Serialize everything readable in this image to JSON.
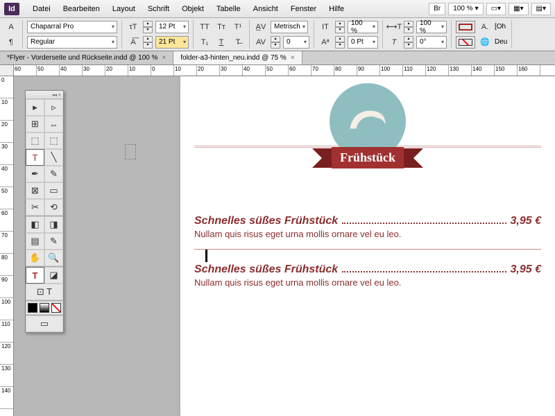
{
  "app": "Id",
  "menu": [
    "Datei",
    "Bearbeiten",
    "Layout",
    "Schrift",
    "Objekt",
    "Tabelle",
    "Ansicht",
    "Fenster",
    "Hilfe"
  ],
  "menuRight": {
    "br": "Br",
    "zoom": "100 %"
  },
  "ctrl": {
    "font": "Chaparral Pro",
    "style": "Regular",
    "size": "12 Pt",
    "leading": "21 Pt",
    "kernMode": "Metrisch",
    "kernVal": "0",
    "vshift": "0 Pt",
    "vscale": "100 %",
    "hscale": "100 %",
    "baseline": "0 Pt",
    "skew": "0°",
    "oh": "[Oh",
    "deu": "Deu"
  },
  "tabs": [
    {
      "label": "*Flyer - Vorderseite und Rückseite.indd @ 100 %",
      "active": false
    },
    {
      "label": "folder-a3-hinten_neu.indd @ 75 %",
      "active": true
    }
  ],
  "hruler": [
    "60",
    "50",
    "40",
    "30",
    "20",
    "10",
    "0",
    "10",
    "20",
    "30",
    "40",
    "50",
    "60",
    "70",
    "80",
    "90",
    "100",
    "110",
    "120",
    "130",
    "140",
    "150",
    "160"
  ],
  "vruler": [
    "0",
    "10",
    "20",
    "30",
    "40",
    "50",
    "60",
    "70",
    "80",
    "90",
    "100",
    "110",
    "120",
    "130",
    "140"
  ],
  "doc": {
    "badge": "Frühstück",
    "item1": {
      "name": "Schnelles süßes Frühstück",
      "price": "3,95 €",
      "desc": "Nullam quis risus eget urna mollis ornare vel eu leo."
    },
    "item2": {
      "name": "Schnelles süßes Frühstück",
      "price": "3,95 €",
      "desc": "Nullam quis risus eget urna mollis ornare vel eu leo."
    }
  }
}
